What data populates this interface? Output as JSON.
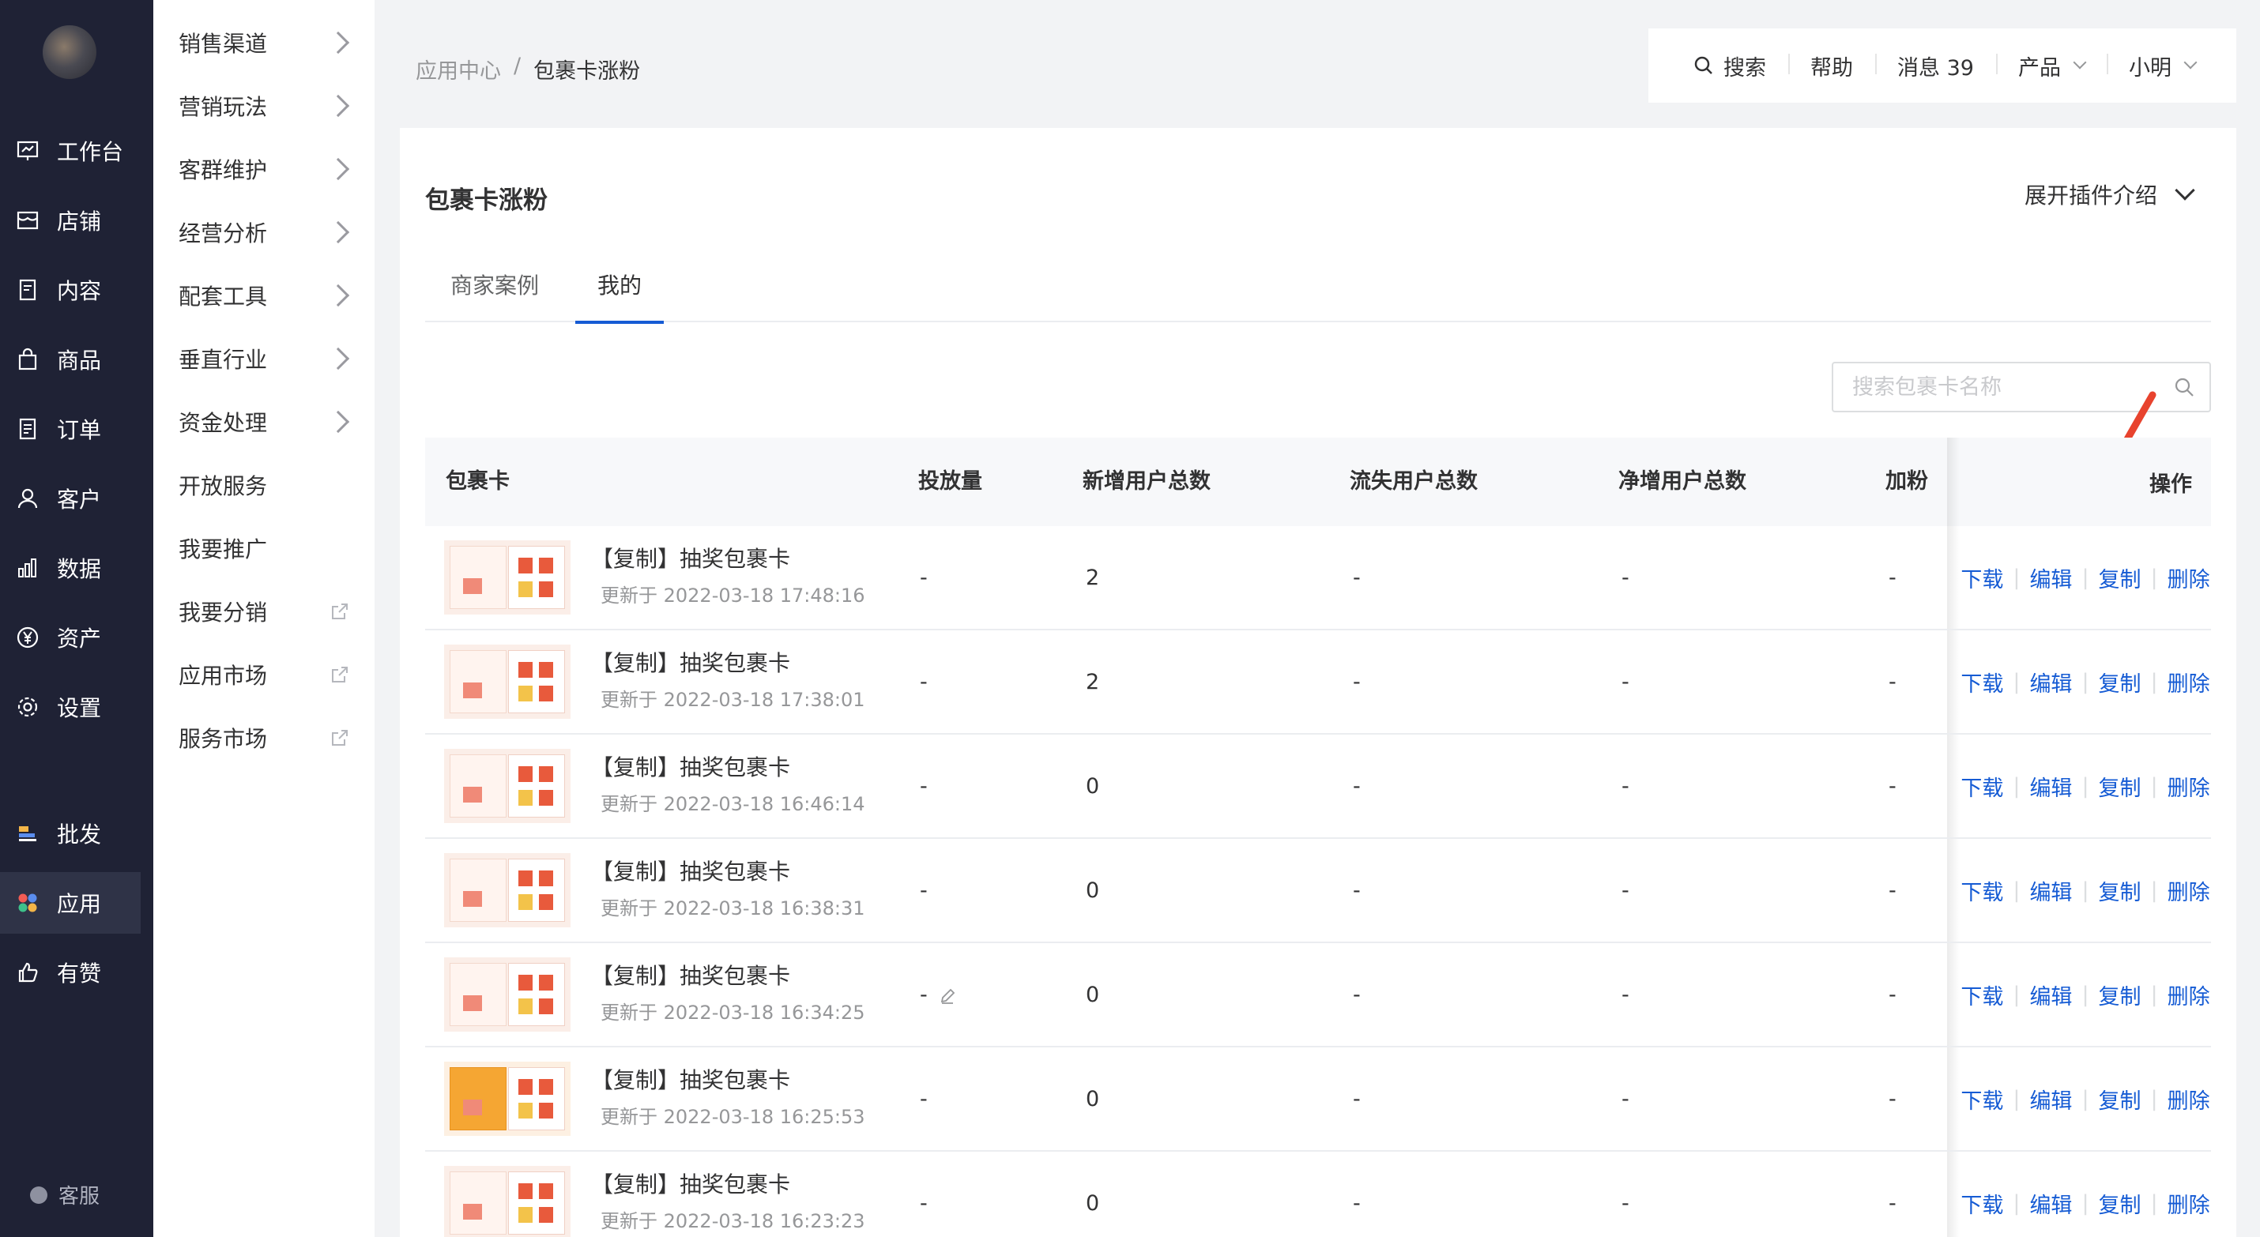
{
  "nav": {
    "items": [
      {
        "label": "工作台",
        "icon": "workbench-icon"
      },
      {
        "label": "店铺",
        "icon": "store-icon"
      },
      {
        "label": "内容",
        "icon": "content-icon"
      },
      {
        "label": "商品",
        "icon": "goods-bag-icon"
      },
      {
        "label": "订单",
        "icon": "order-icon"
      },
      {
        "label": "客户",
        "icon": "customer-icon"
      },
      {
        "label": "数据",
        "icon": "data-chart-icon"
      },
      {
        "label": "资产",
        "icon": "yen-asset-icon"
      },
      {
        "label": "设置",
        "icon": "gear-icon"
      }
    ],
    "bottom_items": [
      {
        "label": "批发",
        "icon": "wholesale-icon"
      },
      {
        "label": "应用",
        "icon": "apps-icon",
        "active": true
      },
      {
        "label": "有赞",
        "icon": "thumbs-up-icon"
      }
    ],
    "support": "客服"
  },
  "submenu": {
    "items": [
      {
        "label": "销售渠道",
        "kind": "chevron"
      },
      {
        "label": "营销玩法",
        "kind": "chevron"
      },
      {
        "label": "客群维护",
        "kind": "chevron"
      },
      {
        "label": "经营分析",
        "kind": "chevron"
      },
      {
        "label": "配套工具",
        "kind": "chevron"
      },
      {
        "label": "垂直行业",
        "kind": "chevron"
      },
      {
        "label": "资金处理",
        "kind": "chevron"
      },
      {
        "label": "开放服务",
        "kind": "none"
      },
      {
        "label": "我要推广",
        "kind": "none"
      },
      {
        "label": "我要分销",
        "kind": "external"
      },
      {
        "label": "应用市场",
        "kind": "external"
      },
      {
        "label": "服务市场",
        "kind": "external"
      }
    ]
  },
  "breadcrumb": {
    "parent": "应用中心",
    "separator": "/",
    "current": "包裹卡涨粉"
  },
  "topbar": {
    "search": "搜索",
    "help": "帮助",
    "messages": "消息 39",
    "product": "产品",
    "user": "小明"
  },
  "page": {
    "title": "包裹卡涨粉",
    "expand_label": "展开插件介绍",
    "tabs": [
      {
        "label": "商家案例",
        "active": false
      },
      {
        "label": "我的",
        "active": true
      }
    ],
    "search_placeholder": "搜索包裹卡名称"
  },
  "table": {
    "columns": [
      "包裹卡",
      "投放量",
      "新增用户总数",
      "流失用户总数",
      "净增用户总数",
      "加粉",
      "操作"
    ],
    "actions": [
      "下载",
      "编辑",
      "复制",
      "删除"
    ],
    "rows": [
      {
        "name": "【复制】抽奖包裹卡",
        "updated": "更新于 2022-03-18 17:48:16",
        "volume": "-",
        "new_users": "2",
        "lost_users": "-",
        "net_users": "-",
        "fans": "-"
      },
      {
        "name": "【复制】抽奖包裹卡",
        "updated": "更新于 2022-03-18 17:38:01",
        "volume": "-",
        "new_users": "2",
        "lost_users": "-",
        "net_users": "-",
        "fans": "-"
      },
      {
        "name": "【复制】抽奖包裹卡",
        "updated": "更新于 2022-03-18 16:46:14",
        "volume": "-",
        "new_users": "0",
        "lost_users": "-",
        "net_users": "-",
        "fans": "-"
      },
      {
        "name": "【复制】抽奖包裹卡",
        "updated": "更新于 2022-03-18 16:38:31",
        "volume": "-",
        "new_users": "0",
        "lost_users": "-",
        "net_users": "-",
        "fans": "-"
      },
      {
        "name": "【复制】抽奖包裹卡",
        "updated": "更新于 2022-03-18 16:34:25",
        "volume": "-",
        "new_users": "0",
        "lost_users": "-",
        "net_users": "-",
        "fans": "-",
        "editable": true
      },
      {
        "name": "【复制】抽奖包裹卡",
        "updated": "更新于 2022-03-18 16:25:53",
        "volume": "-",
        "new_users": "0",
        "lost_users": "-",
        "net_users": "-",
        "fans": "-",
        "thumb": "orange"
      },
      {
        "name": "【复制】抽奖包裹卡",
        "updated": "更新于 2022-03-18 16:23:23",
        "volume": "-",
        "new_users": "0",
        "lost_users": "-",
        "net_users": "-",
        "fans": "-"
      }
    ]
  },
  "colors": {
    "nav_bg": "#1f2235",
    "link": "#155bd4",
    "annotation": "#e8432e"
  }
}
